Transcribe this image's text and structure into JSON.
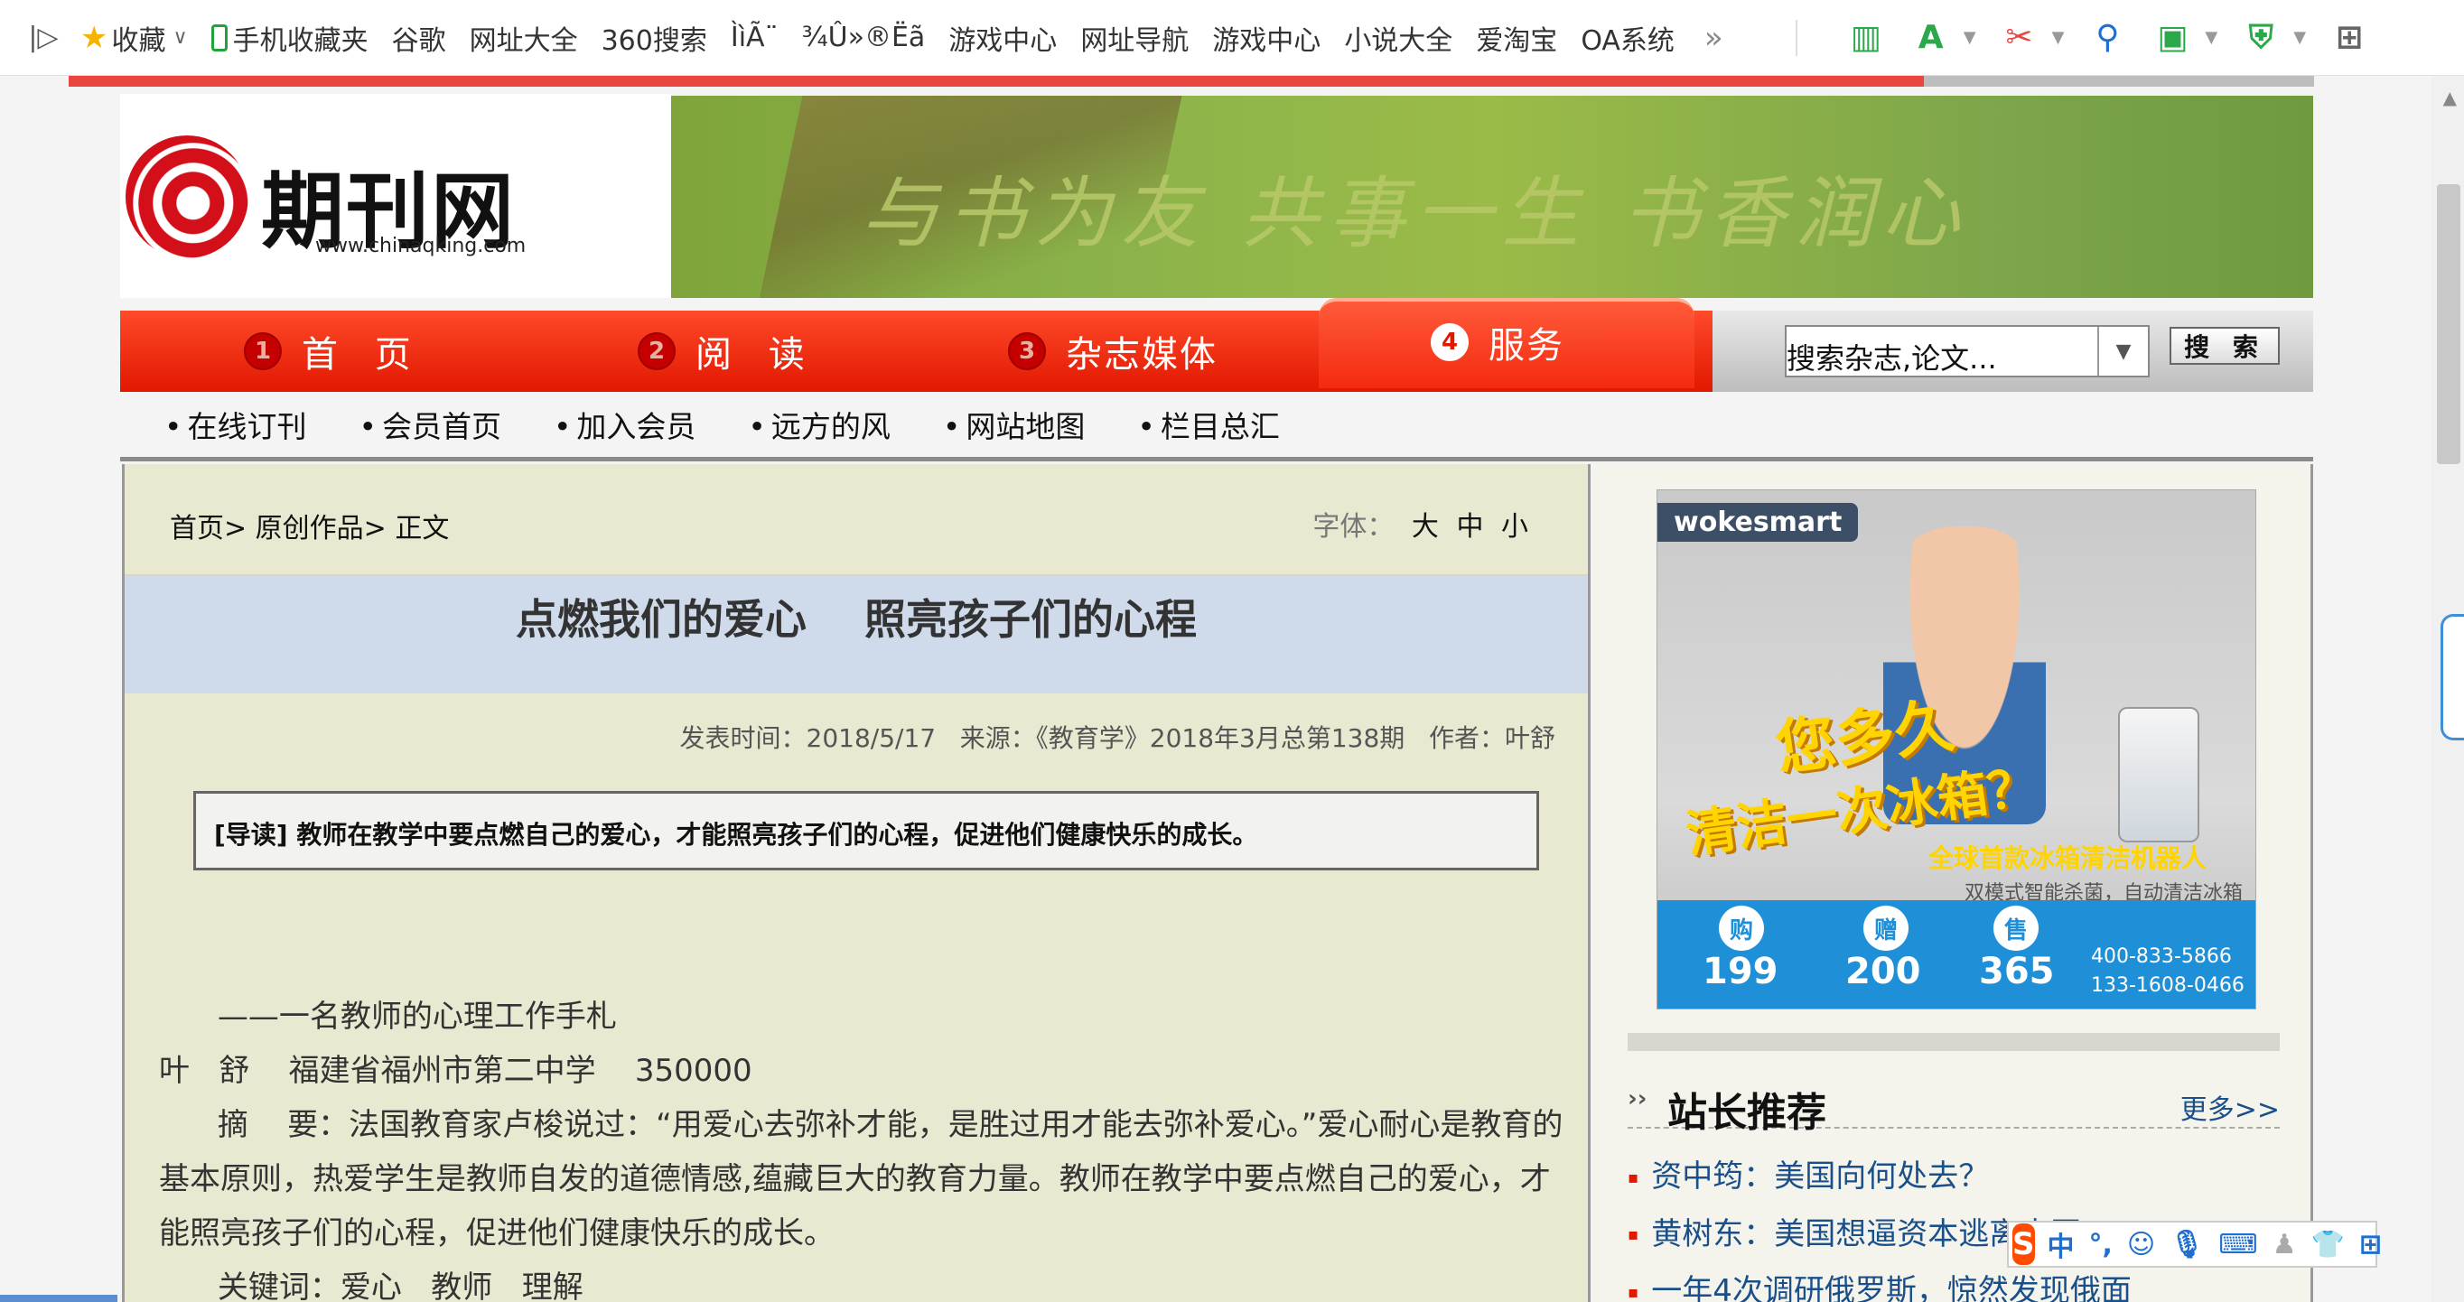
{
  "favbar": {
    "items": [
      "收藏",
      "手机收藏夹",
      "谷歌",
      "网址大全",
      "360搜索",
      "ÌìÃ¨",
      "¾Û»®Ëã",
      "游戏中心",
      "网址导航",
      "游戏中心",
      "小说大全",
      "爱淘宝",
      "OA系统"
    ],
    "more": "»"
  },
  "site": {
    "logo_text": "期刊网",
    "logo_url": "www.chinaqking.com",
    "banner_text": "与书为友  共事一生  书香润心"
  },
  "nav": {
    "items": [
      {
        "num": "1",
        "label": "首 页"
      },
      {
        "num": "2",
        "label": "阅 读"
      },
      {
        "num": "3",
        "label": "杂志媒体"
      },
      {
        "num": "4",
        "label": "服务"
      }
    ],
    "search_placeholder": "搜索杂志,论文...",
    "search_button": "搜 索"
  },
  "subnav": [
    "在线订刊",
    "会员首页",
    "加入会员",
    "远方的风",
    "网站地图",
    "栏目总汇"
  ],
  "article": {
    "breadcrumb": "首页> 原创作品> 正文",
    "font_label": "字体：",
    "font_sizes": [
      "大",
      "中",
      "小"
    ],
    "title": "点燃我们的爱心    照亮孩子们的心程",
    "meta": "发表时间：2018/5/17   来源：《教育学》2018年3月总第138期   作者：叶舒",
    "lead": "[导读] 教师在教学中要点燃自己的爱心，才能照亮孩子们的心程，促进他们健康快乐的成长。",
    "paragraphs": [
      "      ——一名教师的心理工作手札",
      "叶   舒    福建省福州市第二中学    350000",
      "      摘    要：法国教育家卢梭说过：“用爱心去弥补才能，是胜过用才能去弥补爱心。”爱心耐心是教育的基本原则，热爱学生是教师自发的道德情感,蕴藏巨大的教育力量。教师在教学中要点燃自己的爱心，才能照亮孩子们的心程，促进他们健康快乐的成长。",
      "      关键词：爱心   教师   理解"
    ]
  },
  "ad": {
    "brand": "wokesmart",
    "headline1": "您多久",
    "headline2": "清洁一次冰箱？",
    "tagline": "全球首款冰箱清洁机器人",
    "subline": "双模式智能杀菌，自动清洁冰箱",
    "badges": [
      {
        "icon": "购",
        "num": "199"
      },
      {
        "icon": "赠",
        "num": "200"
      },
      {
        "icon": "售",
        "num": "365"
      }
    ],
    "phone1": "400-833-5866",
    "phone2": "133-1608-0466"
  },
  "recommend": {
    "title": "站长推荐",
    "more": "更多>>",
    "items": [
      "资中筠：美国向何处去？",
      "黄树东：美国想逼资本逃离中国",
      "一年4次调研俄罗斯，惊然发现俄面"
    ]
  },
  "ime": {
    "logo": "S",
    "mode": "中",
    "punct": "°,"
  }
}
